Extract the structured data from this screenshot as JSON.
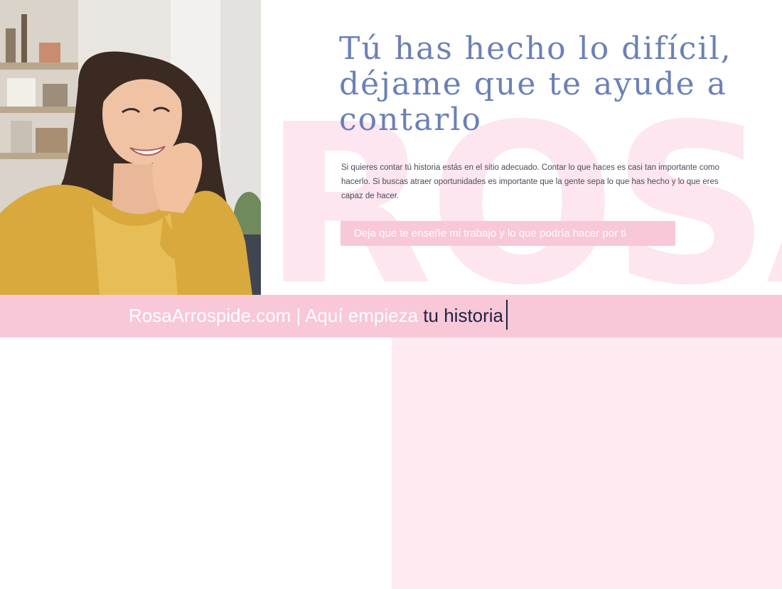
{
  "hero": {
    "watermark": "ROSA",
    "headline": "Tú has hecho lo difícil, déjame que te ayude a contarlo",
    "intro": "Si quieres contar tú historia estás en el sitio adecuado. Contar lo que haces es casi tan importante como hacerlo. Si buscas atraer oportunidades es importante que la gente sepa lo que has hecho y lo que eres capaz de hacer.",
    "cta_label": "Deja que te enseñe mi trabajo y lo que podría hacer por ti",
    "photo_alt": "portrait-photo"
  },
  "tagline": {
    "prefix": "RosaArrospide.com | Aquí empieza ",
    "highlight": "tu historia"
  },
  "colors": {
    "brand_blue": "#6b80b6",
    "brand_pink": "#f8c7d8",
    "panel_pink": "#fdebf1",
    "watermark_pink": "#fde6ef",
    "accent_navy": "#1e2340"
  }
}
